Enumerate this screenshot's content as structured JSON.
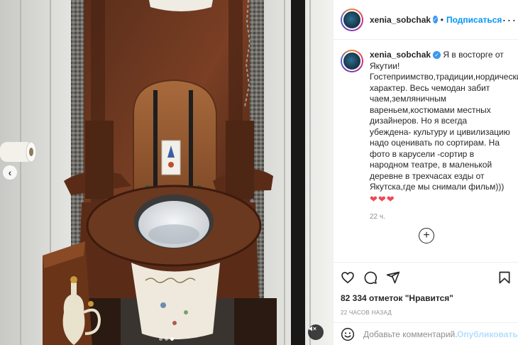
{
  "post": {
    "username": "xenia_sobchak",
    "separator": "•",
    "follow_label": "Подписаться",
    "more_label": "···",
    "caption": "Я в восторге от Якутии! Гостеприимство,традиции,нордический характер. Весь чемодан забит чаем,земляничным вареньем,костюмами местных дизайнеров. Но я всегда убеждена- культуру и цивилизацию надо оценивать по сортирам. На фото в карусели -сортир в народном театре, в маленькой деревне в трехчасах езды от Якутска,где мы снимали фильм)))",
    "hearts": "❤❤❤",
    "time_ago": "22 ч.",
    "likes_count": "82 334",
    "likes_suffix": "отметок \"Нравится\"",
    "date": "22 ЧАСОВ НАЗАД",
    "comment_placeholder": "Добавьте комментарий...",
    "publish_label": "Опубликовать"
  },
  "media": {
    "carousel_total": 3,
    "carousel_active": 3,
    "prev_label": "‹"
  },
  "icons": {
    "avatar": "avatar",
    "verified": "verified-badge-icon",
    "like": "heart-icon",
    "comment": "comment-icon",
    "share": "share-icon",
    "save": "bookmark-icon",
    "emoji": "emoji-icon",
    "mute": "mute-icon",
    "load_more": "plus-circle-icon"
  },
  "colors": {
    "accent": "#0095f6",
    "verified": "#3897f0",
    "heart": "#ed4956",
    "muted_text": "#8e8e8e",
    "publish_disabled": "#b2dffc"
  }
}
